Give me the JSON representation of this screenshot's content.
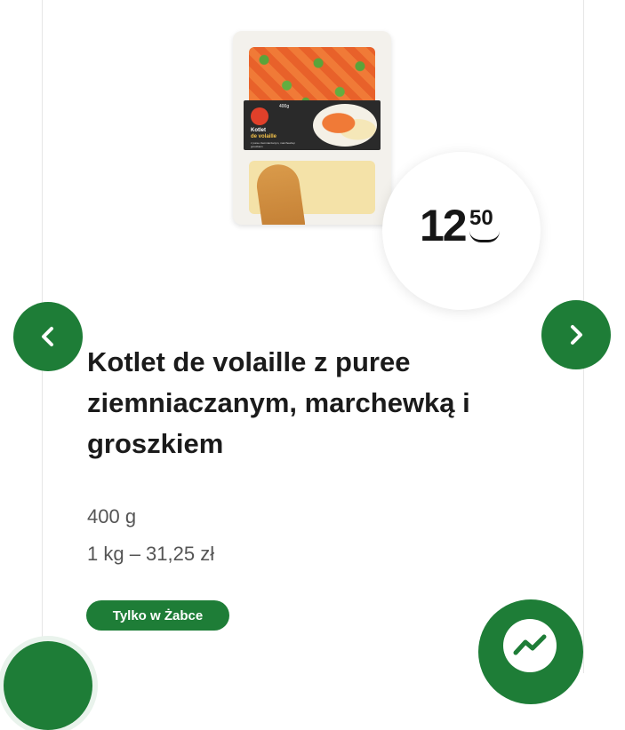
{
  "product": {
    "title": "Kotlet de volaille z puree ziemniaczanym, marchewką i groszkiem",
    "weight": "400 g",
    "unit_price": "1 kg – 31,25 zł",
    "badge": "Tylko w Żabce",
    "price": {
      "main": "12",
      "cents": "50"
    }
  },
  "package": {
    "weight_label": "400g",
    "name_line1": "Kotlet",
    "name_line2": "de volaille",
    "sub": "z puree ziemniaczanym, marchewką i groszkiem"
  },
  "icons": {
    "prev": "chevron-left-icon",
    "next": "chevron-right-icon",
    "messenger": "messenger-icon"
  },
  "colors": {
    "accent": "#1e7d37",
    "title": "#1b1b1b",
    "muted": "#555555"
  }
}
